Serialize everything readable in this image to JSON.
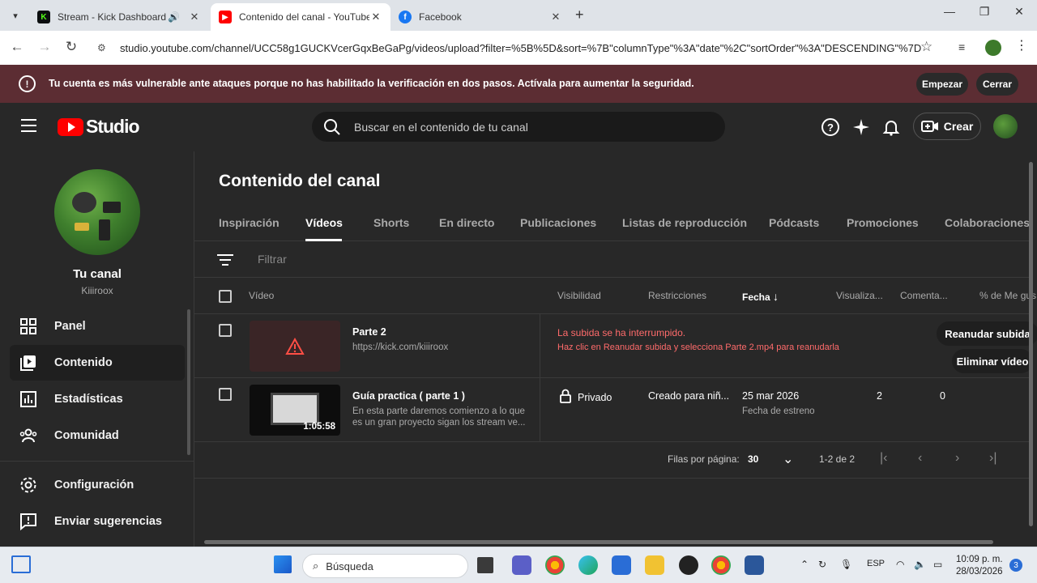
{
  "browser": {
    "tabs": [
      {
        "label": "Stream - Kick Dashboard",
        "icon": "kick-icon",
        "color": "#53fc18"
      },
      {
        "label": "Contenido del canal - YouTube",
        "icon": "youtube-icon",
        "color": "#ff0000"
      },
      {
        "label": "Facebook",
        "icon": "facebook-icon",
        "color": "#1877f2"
      }
    ],
    "url": "studio.youtube.com/channel/UCC58g1GUCKVcerGqxBeGaPg/videos/upload?filter=%5B%5D&sort=%7B\"columnType\"%3A\"date\"%2C\"sortOrder\"%3A\"DESCENDING\"%7D"
  },
  "banner": {
    "text": "Tu cuenta es más vulnerable ante ataques porque no has habilitado la verificación en dos pasos. Actívala para aumentar la seguridad.",
    "start_label": "Empezar",
    "close_label": "Cerrar",
    "color": "#5c2d33"
  },
  "header": {
    "logo_text": "Studio",
    "search_placeholder": "Buscar en el contenido de tu canal",
    "create_label": "Crear"
  },
  "sidebar": {
    "channel_title": "Tu canal",
    "channel_handle": "Kiiiroox",
    "items": [
      {
        "label": "Panel",
        "icon": "dashboard-icon"
      },
      {
        "label": "Contenido",
        "icon": "content-icon"
      },
      {
        "label": "Estadísticas",
        "icon": "analytics-icon"
      },
      {
        "label": "Comunidad",
        "icon": "community-icon"
      },
      {
        "label": "Configuración",
        "icon": "settings-icon"
      },
      {
        "label": "Enviar sugerencias",
        "icon": "feedback-icon"
      }
    ]
  },
  "main": {
    "title": "Contenido del canal",
    "tabs": [
      "Inspiración",
      "Vídeos",
      "Shorts",
      "En directo",
      "Publicaciones",
      "Listas de reproducción",
      "Pódcasts",
      "Promociones",
      "Colaboraciones"
    ],
    "active_tab": "Vídeos",
    "filter_placeholder": "Filtrar",
    "columns": {
      "video": "Vídeo",
      "visibility": "Visibilidad",
      "restrictions": "Restricciones",
      "date": "Fecha",
      "views": "Visualiza...",
      "comments": "Comenta...",
      "likes": "% de Me gus"
    },
    "rows": [
      {
        "title": "Parte 2",
        "description": "https://kick.com/kiiiroox",
        "error_title": "La subida se ha interrumpido.",
        "error_detail": "Haz clic en Reanudar subida y selecciona Parte 2.mp4 para reanudarla",
        "resume_label": "Reanudar subida",
        "delete_label": "Eliminar vídeo"
      },
      {
        "title": "Guía practica ( parte 1 )",
        "description": "En esta parte daremos comienzo a lo que es un gran proyecto sigan los stream ve...",
        "duration": "1:05:58",
        "visibility": "Privado",
        "restrictions": "Creado para niñ...",
        "date": "25 mar 2026",
        "date_note": "Fecha de estreno",
        "views": "2",
        "comments": "0"
      }
    ],
    "pagination": {
      "rows_per_page_label": "Filas por página:",
      "rows_per_page": "30",
      "range": "1-2 de 2"
    }
  },
  "taskbar": {
    "search_placeholder": "Búsqueda",
    "language": "ESP",
    "time": "10:09 p. m.",
    "date": "28/03/2026",
    "notifications": "3"
  }
}
